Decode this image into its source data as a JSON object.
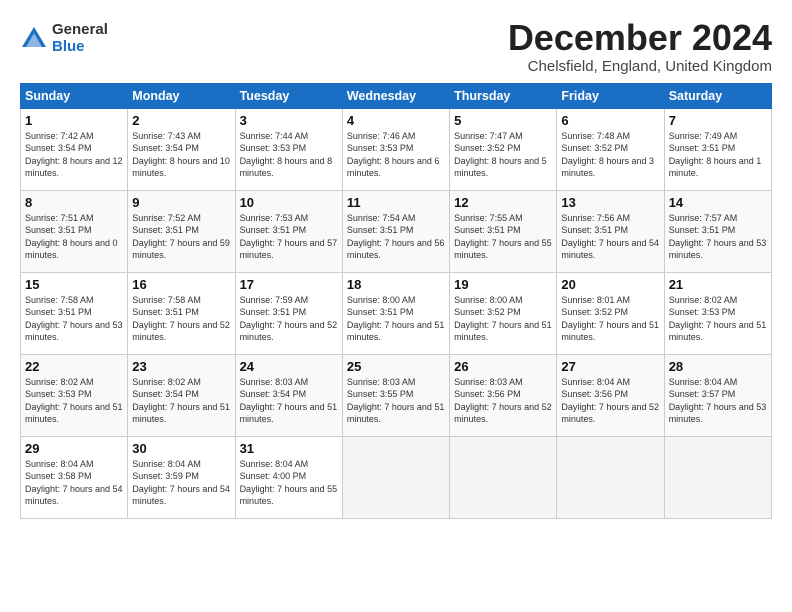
{
  "logo": {
    "general": "General",
    "blue": "Blue"
  },
  "title": "December 2024",
  "location": "Chelsfield, England, United Kingdom",
  "days_of_week": [
    "Sunday",
    "Monday",
    "Tuesday",
    "Wednesday",
    "Thursday",
    "Friday",
    "Saturday"
  ],
  "weeks": [
    [
      {
        "day": "1",
        "rise": "7:42 AM",
        "set": "3:54 PM",
        "daylight": "8 hours and 12 minutes."
      },
      {
        "day": "2",
        "rise": "7:43 AM",
        "set": "3:54 PM",
        "daylight": "8 hours and 10 minutes."
      },
      {
        "day": "3",
        "rise": "7:44 AM",
        "set": "3:53 PM",
        "daylight": "8 hours and 8 minutes."
      },
      {
        "day": "4",
        "rise": "7:46 AM",
        "set": "3:53 PM",
        "daylight": "8 hours and 6 minutes."
      },
      {
        "day": "5",
        "rise": "7:47 AM",
        "set": "3:52 PM",
        "daylight": "8 hours and 5 minutes."
      },
      {
        "day": "6",
        "rise": "7:48 AM",
        "set": "3:52 PM",
        "daylight": "8 hours and 3 minutes."
      },
      {
        "day": "7",
        "rise": "7:49 AM",
        "set": "3:51 PM",
        "daylight": "8 hours and 1 minute."
      }
    ],
    [
      {
        "day": "8",
        "rise": "7:51 AM",
        "set": "3:51 PM",
        "daylight": "8 hours and 0 minutes."
      },
      {
        "day": "9",
        "rise": "7:52 AM",
        "set": "3:51 PM",
        "daylight": "7 hours and 59 minutes."
      },
      {
        "day": "10",
        "rise": "7:53 AM",
        "set": "3:51 PM",
        "daylight": "7 hours and 57 minutes."
      },
      {
        "day": "11",
        "rise": "7:54 AM",
        "set": "3:51 PM",
        "daylight": "7 hours and 56 minutes."
      },
      {
        "day": "12",
        "rise": "7:55 AM",
        "set": "3:51 PM",
        "daylight": "7 hours and 55 minutes."
      },
      {
        "day": "13",
        "rise": "7:56 AM",
        "set": "3:51 PM",
        "daylight": "7 hours and 54 minutes."
      },
      {
        "day": "14",
        "rise": "7:57 AM",
        "set": "3:51 PM",
        "daylight": "7 hours and 53 minutes."
      }
    ],
    [
      {
        "day": "15",
        "rise": "7:58 AM",
        "set": "3:51 PM",
        "daylight": "7 hours and 53 minutes."
      },
      {
        "day": "16",
        "rise": "7:58 AM",
        "set": "3:51 PM",
        "daylight": "7 hours and 52 minutes."
      },
      {
        "day": "17",
        "rise": "7:59 AM",
        "set": "3:51 PM",
        "daylight": "7 hours and 52 minutes."
      },
      {
        "day": "18",
        "rise": "8:00 AM",
        "set": "3:51 PM",
        "daylight": "7 hours and 51 minutes."
      },
      {
        "day": "19",
        "rise": "8:00 AM",
        "set": "3:52 PM",
        "daylight": "7 hours and 51 minutes."
      },
      {
        "day": "20",
        "rise": "8:01 AM",
        "set": "3:52 PM",
        "daylight": "7 hours and 51 minutes."
      },
      {
        "day": "21",
        "rise": "8:02 AM",
        "set": "3:53 PM",
        "daylight": "7 hours and 51 minutes."
      }
    ],
    [
      {
        "day": "22",
        "rise": "8:02 AM",
        "set": "3:53 PM",
        "daylight": "7 hours and 51 minutes."
      },
      {
        "day": "23",
        "rise": "8:02 AM",
        "set": "3:54 PM",
        "daylight": "7 hours and 51 minutes."
      },
      {
        "day": "24",
        "rise": "8:03 AM",
        "set": "3:54 PM",
        "daylight": "7 hours and 51 minutes."
      },
      {
        "day": "25",
        "rise": "8:03 AM",
        "set": "3:55 PM",
        "daylight": "7 hours and 51 minutes."
      },
      {
        "day": "26",
        "rise": "8:03 AM",
        "set": "3:56 PM",
        "daylight": "7 hours and 52 minutes."
      },
      {
        "day": "27",
        "rise": "8:04 AM",
        "set": "3:56 PM",
        "daylight": "7 hours and 52 minutes."
      },
      {
        "day": "28",
        "rise": "8:04 AM",
        "set": "3:57 PM",
        "daylight": "7 hours and 53 minutes."
      }
    ],
    [
      {
        "day": "29",
        "rise": "8:04 AM",
        "set": "3:58 PM",
        "daylight": "7 hours and 54 minutes."
      },
      {
        "day": "30",
        "rise": "8:04 AM",
        "set": "3:59 PM",
        "daylight": "7 hours and 54 minutes."
      },
      {
        "day": "31",
        "rise": "8:04 AM",
        "set": "4:00 PM",
        "daylight": "7 hours and 55 minutes."
      },
      null,
      null,
      null,
      null
    ]
  ],
  "labels": {
    "sunrise": "Sunrise:",
    "sunset": "Sunset:",
    "daylight": "Daylight:"
  }
}
